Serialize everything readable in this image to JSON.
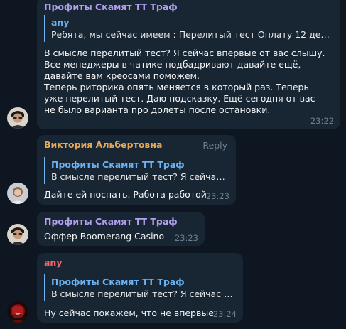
{
  "messages": [
    {
      "sender": "Профиты Скамят ТТ Траф",
      "sender_color": "#b5a0f0",
      "quote_name": "any",
      "quote_text": "Ребята, мы сейчас имеем :  Перелитый тест  Оплату 12 депози...",
      "text": "В смысле перелитый тест? Я сейчас впервые от вас слышу. Все менеджеры в чатике подбадривают давайте ещё, давайте вам креосами поможем.\nТеперь риторика опять меняется в который раз. Теперь уже перелитый тест. Даю подсказку. Ещё сегодня от вас не было варианта про долеты после остановки.",
      "time": "23:22"
    },
    {
      "sender": "Виктория Альбертовна",
      "sender_color": "#e9a857",
      "reply_label": "Reply",
      "quote_name": "Профиты Скамят ТТ Траф",
      "quote_text": "В смысле перелитый тест? Я сейчас впе...",
      "text": "Дайте ей поспать. Работа работой",
      "time": "23:23"
    },
    {
      "sender": "Профиты Скамят ТТ Траф",
      "sender_color": "#b5a0f0",
      "text": "Оффер Boomerang Casino",
      "time": "23:23"
    },
    {
      "sender": "any",
      "sender_color": "#ef6a6a",
      "quote_name": "Профиты Скамят ТТ Траф",
      "quote_text": "В смысле перелитый тест? Я сейчас впе...",
      "text": "Ну сейчас покажем, что не впервые",
      "time": "23:24"
    }
  ]
}
